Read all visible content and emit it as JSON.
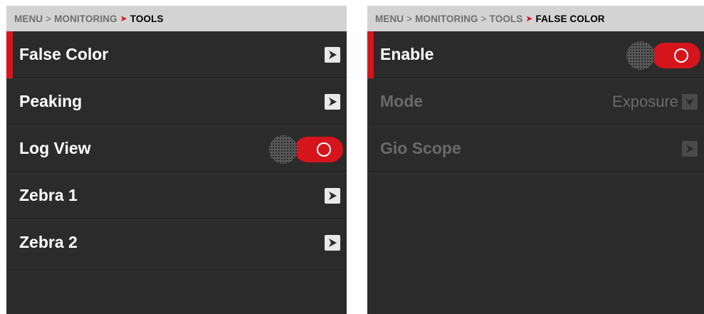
{
  "left_panel": {
    "breadcrumb": {
      "items": [
        "MENU",
        "MONITORING"
      ],
      "separator": ">",
      "current": "TOOLS"
    },
    "rows": [
      {
        "label": "False Color",
        "control": "arrow",
        "selected": true
      },
      {
        "label": "Peaking",
        "control": "arrow"
      },
      {
        "label": "Log View",
        "control": "toggle",
        "toggle_on": true
      },
      {
        "label": "Zebra 1",
        "control": "arrow"
      },
      {
        "label": "Zebra 2",
        "control": "arrow"
      }
    ]
  },
  "right_panel": {
    "breadcrumb": {
      "items": [
        "MENU",
        "MONITORING",
        "TOOLS"
      ],
      "separator": ">",
      "current": "FALSE COLOR"
    },
    "rows": [
      {
        "label": "Enable",
        "control": "toggle",
        "toggle_on": true,
        "selected": true
      },
      {
        "label": "Mode",
        "control": "select",
        "value": "Exposure",
        "disabled": true
      },
      {
        "label": "Gio Scope",
        "control": "arrow",
        "disabled": true
      }
    ]
  },
  "colors": {
    "accent_red": "#d6141c",
    "panel_bg": "#2b2b2b",
    "breadcrumb_bg": "#d3d3d3",
    "disabled_text": "#6a6a6a"
  }
}
